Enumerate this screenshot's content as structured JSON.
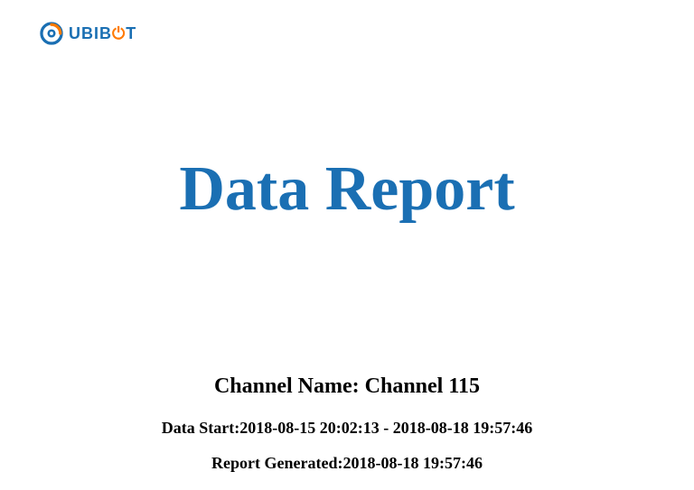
{
  "brand": {
    "name_prefix": "UBIB",
    "name_suffix": "T"
  },
  "report": {
    "title": "Data Report",
    "channel_label": "Channel Name: ",
    "channel_value": "Channel 115",
    "range_label": "Data Start:",
    "range_value": "2018-08-15 20:02:13 - 2018-08-18 19:57:46",
    "generated_label": "Report Generated:",
    "generated_value": "2018-08-18 19:57:46"
  }
}
